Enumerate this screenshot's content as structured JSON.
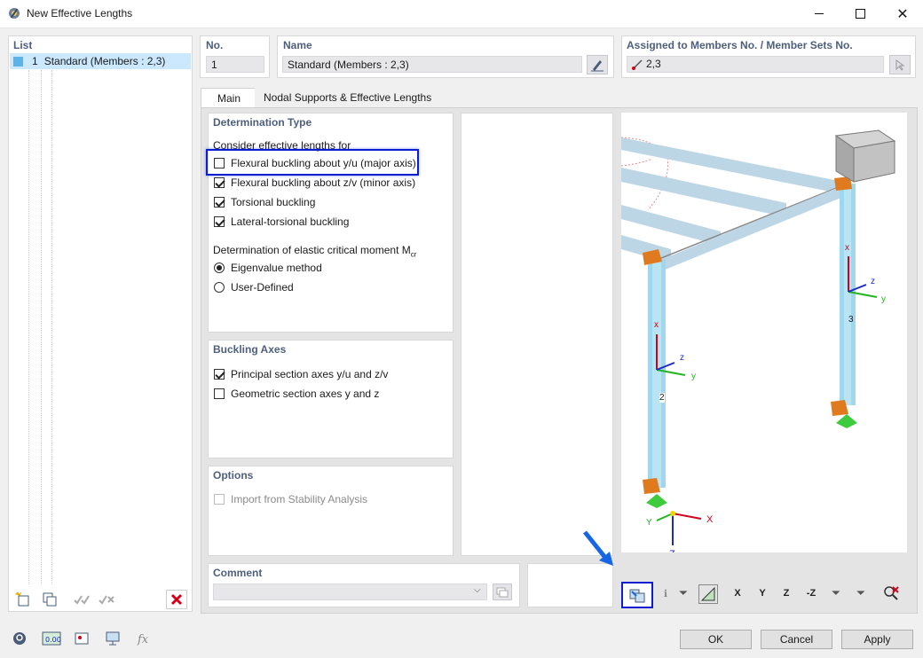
{
  "window": {
    "title": "New Effective Lengths"
  },
  "list": {
    "header": "List",
    "items": [
      {
        "number": "1",
        "label": "Standard (Members : 2,3)"
      }
    ]
  },
  "no": {
    "header": "No.",
    "value": "1"
  },
  "name": {
    "header": "Name",
    "value": "Standard (Members : 2,3)"
  },
  "assigned": {
    "header": "Assigned to Members No. / Member Sets No.",
    "value": "2,3"
  },
  "tabs": [
    {
      "label": "Main"
    },
    {
      "label": "Nodal Supports & Effective Lengths"
    }
  ],
  "determination": {
    "header": "Determination Type",
    "consider_label": "Consider effective lengths for",
    "options": [
      {
        "label": "Flexural buckling about y/u (major axis)",
        "checked": false
      },
      {
        "label": "Flexural buckling about z/v (minor axis)",
        "checked": true
      },
      {
        "label": "Torsional buckling",
        "checked": true
      },
      {
        "label": "Lateral-torsional buckling",
        "checked": true
      }
    ],
    "mcr_label": "Determination of elastic critical moment M",
    "mcr_sub": "cr",
    "methods": [
      {
        "label": "Eigenvalue method",
        "selected": true
      },
      {
        "label": "User-Defined",
        "selected": false
      }
    ]
  },
  "buckling_axes": {
    "header": "Buckling Axes",
    "options": [
      {
        "label": "Principal section axes y/u and z/v",
        "checked": true
      },
      {
        "label": "Geometric section axes y and z",
        "checked": false
      }
    ]
  },
  "options": {
    "header": "Options",
    "import_label": "Import from Stability Analysis"
  },
  "comment": {
    "header": "Comment",
    "value": ""
  },
  "model": {
    "member_labels": [
      "2",
      "3"
    ],
    "axis_labels": {
      "x": "x",
      "y": "y",
      "z": "z"
    },
    "global_axes": {
      "x": "X",
      "y": "Y",
      "z": "Z"
    }
  },
  "view_toolbar": {
    "labels": [
      "X",
      "Y",
      "Z",
      "-Z"
    ]
  },
  "buttons": {
    "ok": "OK",
    "cancel": "Cancel",
    "apply": "Apply"
  },
  "colors": {
    "highlight": "#0a1fd2",
    "arrow": "#1565e6",
    "member": "#9fd8ee",
    "support": "#e07a1f",
    "ground": "#3ecb3e"
  }
}
